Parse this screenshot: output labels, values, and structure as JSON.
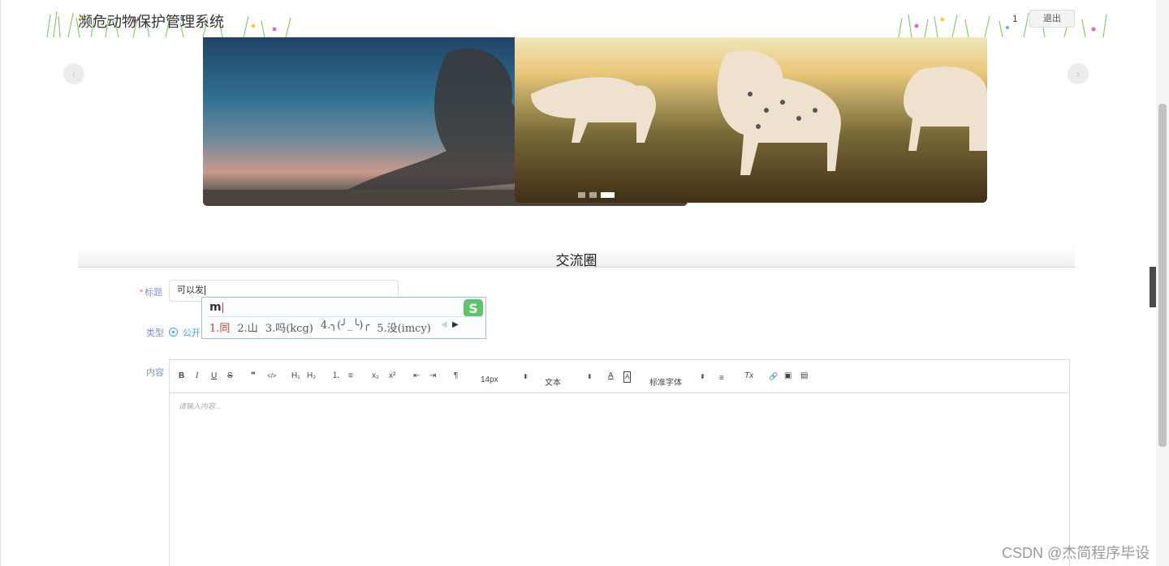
{
  "header": {
    "site_title": "濒危动物保护管理系统",
    "user_name": "1",
    "logout_label": "退出"
  },
  "carousel": {
    "prev_arrow": "‹",
    "next_arrow": "›",
    "slide_count": 3,
    "active_index": 3
  },
  "section": {
    "title": "交流圈"
  },
  "form": {
    "title_label": "标题",
    "title_value": "可以发",
    "type_label": "类型",
    "type_option": "公开",
    "content_label": "内容",
    "content_placeholder": "请输入内容..."
  },
  "ime": {
    "pinyin": "m",
    "candidates": [
      "1.同",
      "2.山",
      "3.吗(kcg)",
      "4.╮(╯_╰)╭",
      "5.没(imcy)"
    ],
    "logo_letter": "S"
  },
  "editor_toolbar": {
    "bold": "B",
    "italic": "I",
    "underline": "U",
    "strike": "S",
    "quote": "❞",
    "code": "</>",
    "h1": "H₁",
    "h2": "H₂",
    "ordered_list": "⒈",
    "bullet_list": "≡",
    "subscript": "x₂",
    "superscript": "x²",
    "outdent": "⇤",
    "indent": "⇥",
    "direction": "¶",
    "font_size": "14px",
    "header_select": "文本",
    "font_color": "A",
    "background_color": "A",
    "font_family": "标准字体",
    "align": "≡",
    "clean": "Tx",
    "link": "🔗",
    "image": "▣",
    "video": "▤"
  },
  "side_tab_icon": "‹",
  "watermark": "CSDN @杰简程序毕设",
  "colors": {
    "accent": "#409eff",
    "label": "#7f95c4",
    "required": "#f56c6c",
    "ime_highlight": "#d23a2a"
  }
}
